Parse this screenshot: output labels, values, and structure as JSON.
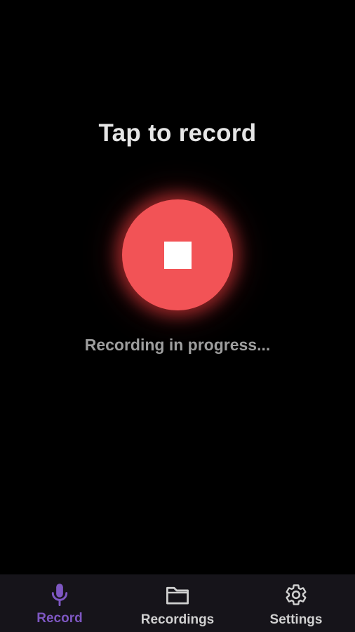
{
  "main": {
    "title": "Tap to record",
    "status": "Recording in progress..."
  },
  "record_button": {
    "icon": "stop-icon",
    "color": "#f25356"
  },
  "bottom_nav": {
    "items": [
      {
        "label": "Record",
        "icon": "microphone-icon",
        "active": true
      },
      {
        "label": "Recordings",
        "icon": "folder-icon",
        "active": false
      },
      {
        "label": "Settings",
        "icon": "gear-icon",
        "active": false
      }
    ],
    "active_color": "#7e57c2",
    "inactive_color": "#d0d0d0",
    "background": "#16141a"
  }
}
